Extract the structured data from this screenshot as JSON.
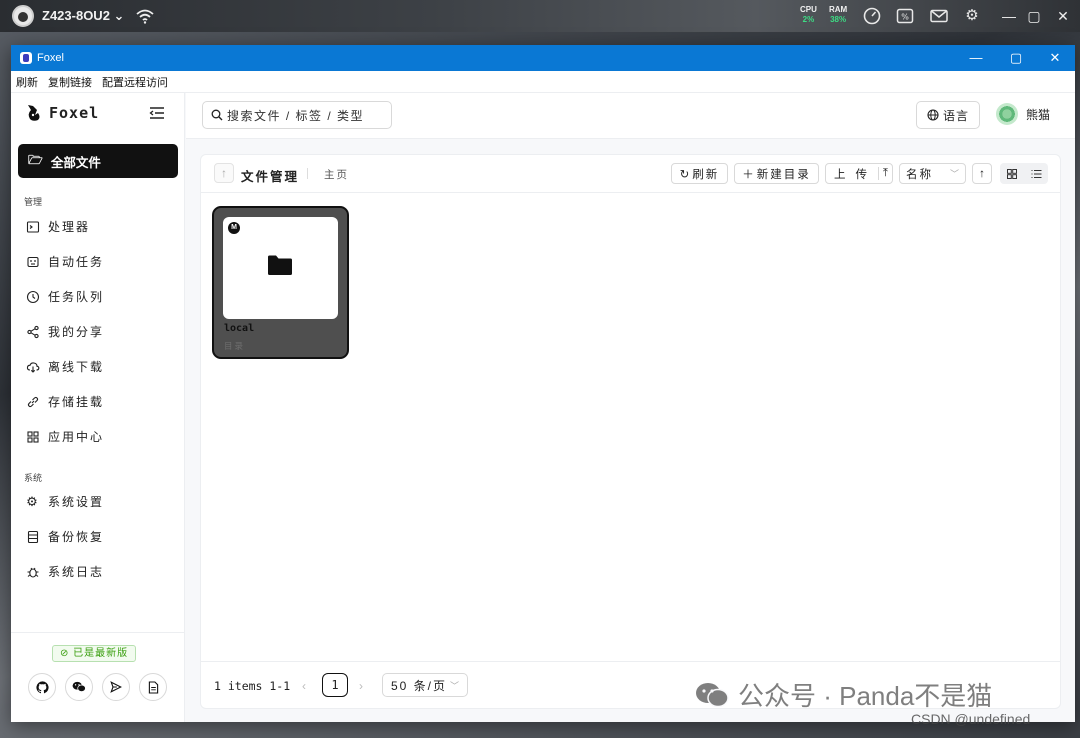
{
  "desktop": {
    "hostname": "Z423-8OU2",
    "cpu": {
      "label": "CPU",
      "value": "2%"
    },
    "ram": {
      "label": "RAM",
      "value": "38%"
    }
  },
  "window": {
    "title": "Foxel",
    "menu": [
      "刷新",
      "复制链接",
      "配置远程访问"
    ]
  },
  "sidebar": {
    "logo": "Foxel",
    "active_item": "全部文件",
    "sections": [
      {
        "label": "管理",
        "items": [
          {
            "label": "处理器",
            "icon": "terminal-icon"
          },
          {
            "label": "自动任务",
            "icon": "robot-icon"
          },
          {
            "label": "任务队列",
            "icon": "clock-icon"
          },
          {
            "label": "我的分享",
            "icon": "share-icon"
          },
          {
            "label": "离线下载",
            "icon": "cloud-download-icon"
          },
          {
            "label": "存储挂载",
            "icon": "link-icon"
          },
          {
            "label": "应用中心",
            "icon": "apps-icon"
          }
        ]
      },
      {
        "label": "系统",
        "items": [
          {
            "label": "系统设置",
            "icon": "gear-icon"
          },
          {
            "label": "备份恢复",
            "icon": "database-icon"
          },
          {
            "label": "系统日志",
            "icon": "bug-icon"
          }
        ]
      }
    ],
    "version_badge": "已是最新版"
  },
  "header": {
    "search_placeholder": "搜索文件 / 标签 / 类型",
    "language_label": "语言",
    "username": "熊猫"
  },
  "file_manager": {
    "title": "文件管理",
    "breadcrumb": "主页",
    "toolbar": {
      "refresh_label": "刷新",
      "new_dir_label": "新建目录",
      "upload_label": "上传",
      "sort_label": "名称"
    },
    "items": [
      {
        "name": "local",
        "type": "目录",
        "badge": "M"
      }
    ],
    "pagination": {
      "total_text": "1 items 1-1",
      "current_page": "1",
      "page_size": "50 条/页"
    }
  },
  "overlay": {
    "watermark": "公众号 · Panda不是猫",
    "csdn": "CSDN @undefined"
  },
  "colors": {
    "titlebar": "#0a78d4",
    "active_nav": "#111111",
    "success": "#389e0d"
  }
}
